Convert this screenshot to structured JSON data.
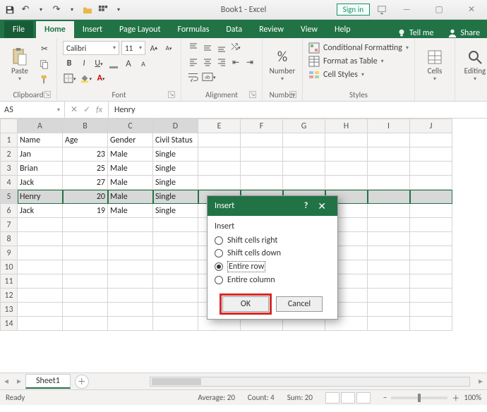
{
  "titlebar": {
    "title": "Book1 - Excel",
    "signin": "Sign in"
  },
  "tabs": {
    "file": "File",
    "home": "Home",
    "insert": "Insert",
    "pageLayout": "Page Layout",
    "formulas": "Formulas",
    "data": "Data",
    "review": "Review",
    "view": "View",
    "help": "Help",
    "tellme": "Tell me",
    "share": "Share"
  },
  "ribbon": {
    "clipboard": {
      "paste": "Paste",
      "label": "Clipboard"
    },
    "font": {
      "name": "Calibri",
      "size": "11",
      "label": "Font"
    },
    "alignment": {
      "label": "Alignment"
    },
    "number": {
      "button": "Number",
      "label": "Number",
      "percent": "%"
    },
    "styles": {
      "conditional": "Conditional Formatting",
      "table": "Format as Table",
      "cell": "Cell Styles",
      "label": "Styles"
    },
    "cells": {
      "label": "Cells"
    },
    "editing": {
      "label": "Editing"
    }
  },
  "formulaBar": {
    "nameBox": "A5",
    "fx": "fx",
    "value": "Henry"
  },
  "columns": [
    "A",
    "B",
    "C",
    "D",
    "E",
    "F",
    "G",
    "H",
    "I",
    "J"
  ],
  "rowHeaders": [
    "1",
    "2",
    "3",
    "4",
    "5",
    "6",
    "7",
    "8",
    "9",
    "10",
    "11",
    "12",
    "13",
    "14"
  ],
  "headerRow": {
    "A": "Name",
    "B": "Age",
    "C": "Gender",
    "D": "Civil Status"
  },
  "dataRows": [
    {
      "A": "Jan",
      "B": "23",
      "C": "Male",
      "D": "Single"
    },
    {
      "A": "Brian",
      "B": "25",
      "C": "Male",
      "D": "Single"
    },
    {
      "A": "Jack",
      "B": "27",
      "C": "Male",
      "D": "Single"
    },
    {
      "A": "Henry",
      "B": "20",
      "C": "Male",
      "D": "Single"
    },
    {
      "A": "Jack",
      "B": "19",
      "C": "Male",
      "D": "Single"
    }
  ],
  "selectedRowIndex": 5,
  "dialog": {
    "title": "Insert",
    "group": "Insert",
    "options": {
      "right": "Shift cells right",
      "down": "Shift cells down",
      "row": "Entire row",
      "column": "Entire column"
    },
    "selected": "row",
    "ok": "OK",
    "cancel": "Cancel"
  },
  "sheetTabs": {
    "sheet1": "Sheet1"
  },
  "status": {
    "ready": "Ready",
    "average": "Average: 20",
    "count": "Count: 4",
    "sum": "Sum: 20",
    "zoom": "100%"
  }
}
